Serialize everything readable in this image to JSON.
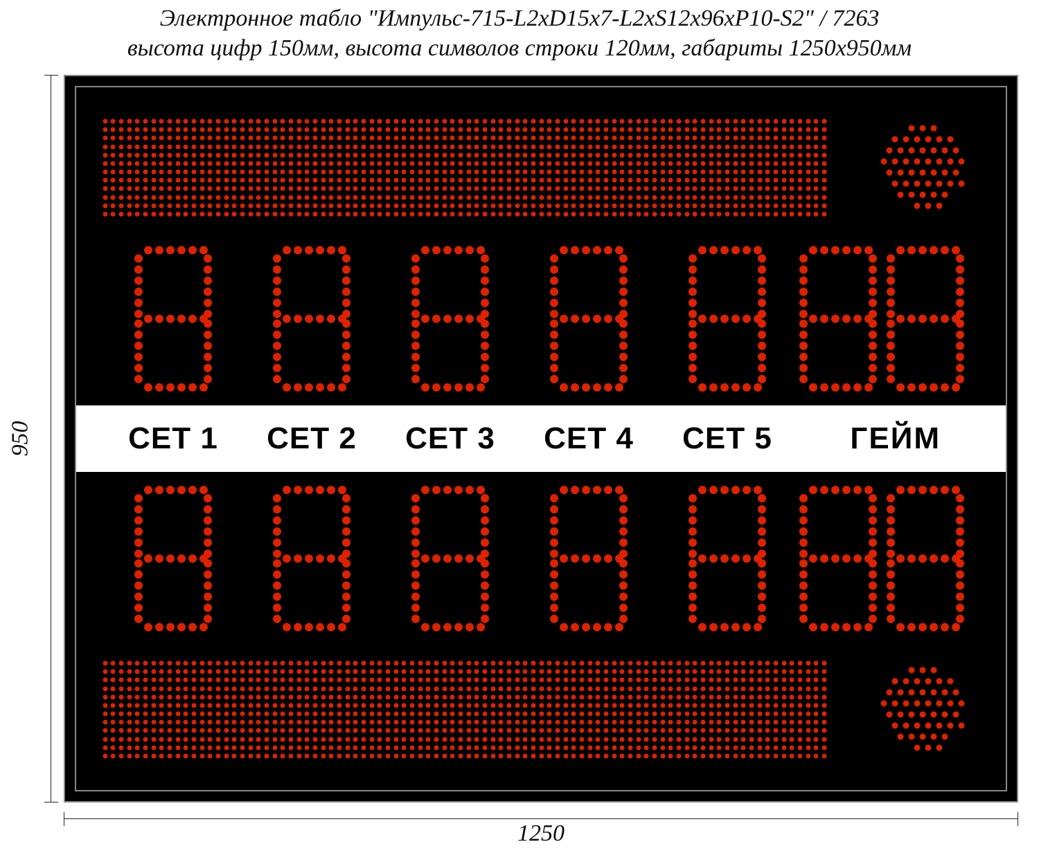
{
  "caption_line1": "Электронное табло \"Импульс-715-L2xD15x7-L2xS12x96xP10-S2\" / 7263",
  "caption_line2": "высота цифр 150мм, высота символов строки 120мм, габариты 1250х950мм",
  "dimensions": {
    "width_label": "1250",
    "height_label": "950"
  },
  "labels": {
    "set1": "СЕТ 1",
    "set2": "СЕТ 2",
    "set3": "СЕТ 3",
    "set4": "СЕТ 4",
    "set5": "СЕТ 5",
    "game": "ГЕЙМ"
  },
  "scoreboard": {
    "top_text_line": "",
    "bottom_text_line": "",
    "row_top": {
      "set1": "8",
      "set2": "8",
      "set3": "8",
      "set4": "8",
      "set5": "8",
      "game": "88"
    },
    "row_bottom": {
      "set1": "8",
      "set2": "8",
      "set3": "8",
      "set4": "8",
      "set5": "8",
      "game": "88"
    }
  },
  "colors": {
    "led": "#d20",
    "board_bg": "#000",
    "frame": "#888"
  }
}
